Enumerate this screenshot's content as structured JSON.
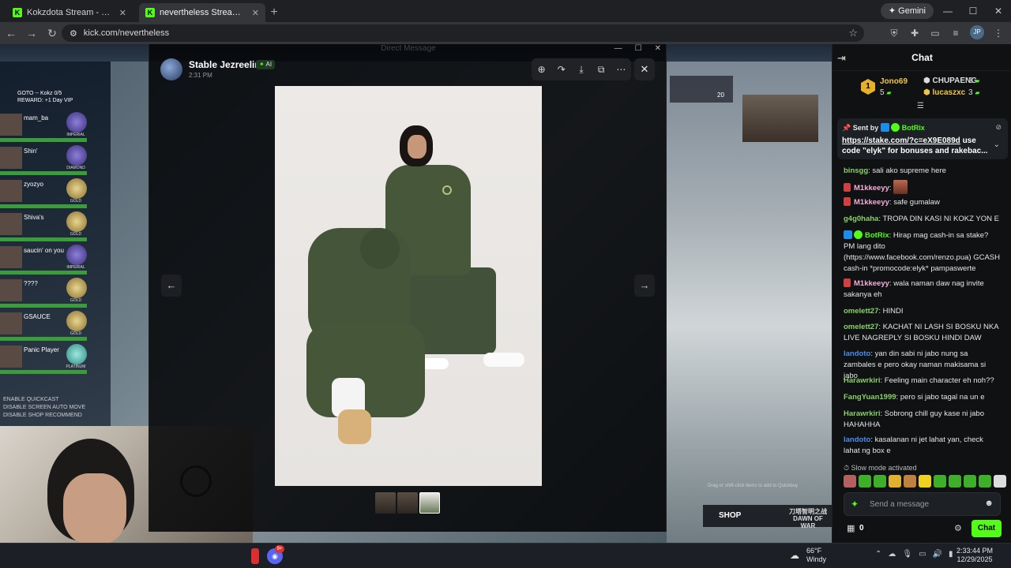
{
  "browser": {
    "tabs": [
      {
        "title": "Kokzdota Stream - Watch Live"
      },
      {
        "title": "nevertheless Stream - Watch Live"
      }
    ],
    "gemini_label": "Gemini",
    "url": "kick.com/nevertheless",
    "profile_initials": "JP"
  },
  "stream": {
    "hero_header": "GOTO -- Kokz 0/5",
    "hero_reward": "REWARD: +1 Day VIP",
    "heroes": [
      {
        "name": "mam_ba",
        "rank": "IMPERIAL"
      },
      {
        "name": "Shin'",
        "rank": "DIAMOND"
      },
      {
        "name": "zyozyo",
        "rank": "GOLD"
      },
      {
        "name": "Shiva's",
        "rank": "GOLD"
      },
      {
        "name": "saucin' on you",
        "rank": "IMPERIAL"
      },
      {
        "name": "????",
        "rank": "GOLD"
      },
      {
        "name": "GSAUCE",
        "rank": "GOLD"
      },
      {
        "name": "Panic Player",
        "rank": "PLATINUM"
      }
    ],
    "quickcast_options": [
      "ENABLE QUICKCAST",
      "DISABLE SCREEN AUTO MOVE",
      "DISABLE SHOP RECOMMEND"
    ],
    "drag_hint": "Drag or shift-click items to add to Quickbuy",
    "shop_label": "SHOP",
    "game_logo": "刀塔智明之战 DAWN OF WAR",
    "score_kills": "20"
  },
  "lightbox": {
    "background_title": "Direct Message",
    "author": "Stable Jezreelino",
    "ai_badge": "AI",
    "time": "2:31 PM",
    "tools": [
      "zoom-in",
      "share",
      "download",
      "open-external",
      "more"
    ],
    "thumbnails": 3,
    "selected_thumbnail": 3
  },
  "chat": {
    "title": "Chat",
    "leaderboard": [
      {
        "rank": "1",
        "name": "Jono69",
        "count": "5"
      },
      {
        "name": "CHUPAENG",
        "count": "3"
      },
      {
        "name": "lucaszxc",
        "count": "3"
      }
    ],
    "pinned": {
      "sent_by_label": "Sent by",
      "sender": "BotRix",
      "link": "https://stake.com/?c=eX9E089d",
      "text": " use code \"elyk\" for bonuses and rakebac..."
    },
    "messages": [
      {
        "user": "binsgg",
        "color": "#8ad06a",
        "text": "sali ako supreme here"
      },
      {
        "user": "M1kkeeyy",
        "color": "#f4b0d8",
        "text": ""
      },
      {
        "user": "M1kkeeyy",
        "color": "#f4b0d8",
        "text": "safe gumalaw"
      },
      {
        "user": "g4g0haha",
        "color": "#8ad06a",
        "text": "TROPA DIN KASI NI KOKZ YON E"
      },
      {
        "user": "BotRix",
        "color": "#53fc18",
        "text": "Hirap mag cash-in sa stake? PM lang dito (https://www.facebook.com/renzo.pua) GCASH cash-in *promocode:elyk* pampaswerte"
      },
      {
        "user": "M1kkeeyy",
        "color": "#f4b0d8",
        "text": "wala naman daw nag invite sakanya eh"
      },
      {
        "user": "omelett27",
        "color": "#8ad06a",
        "text": "HINDI"
      },
      {
        "user": "omelett27",
        "color": "#8ad06a",
        "text": "KACHAT NI LASH SI BOSKU NKA LIVE NAGREPLY SI BOSKU HINDI DAW"
      },
      {
        "user": "landoto",
        "color": "#4a8ef0",
        "text": "yan din sabi ni jabo nung sa zambales e pero okay naman makisama si jabo"
      },
      {
        "user": "Harawrkiri",
        "color": "#8ad06a",
        "text": "Feeling main character eh noh??"
      },
      {
        "user": "FangYuan1999",
        "color": "#8ad06a",
        "text": "pero si jabo tagal na un e"
      },
      {
        "user": "Harawrkiri",
        "color": "#8ad06a",
        "text": "Sobrong chill guy kase ni jabo HAHAHHA"
      },
      {
        "user": "landoto",
        "color": "#4a8ef0",
        "text": "kasalanan ni jet lahat yan, check lahat ng box e"
      }
    ],
    "slow_mode": "Slow mode activated",
    "input_placeholder": "Send a message",
    "gift_count": "0",
    "send_button": "Chat"
  },
  "taskbar": {
    "discord_badge": "9+",
    "temperature": "66°F",
    "weather": "Windy",
    "time": "2:33:44 PM",
    "date": "12/29/2025"
  }
}
